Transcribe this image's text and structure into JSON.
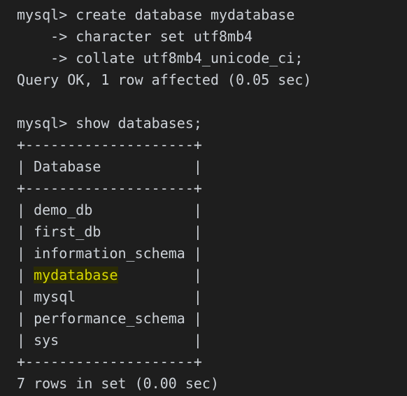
{
  "terminal": {
    "background_color": "#1e1e1e",
    "foreground_color": "#cdd2d8",
    "highlight_text_color": "#d7d700",
    "highlight_background_color": "#2b2b05",
    "prompt": "mysql>",
    "continuation_prompt": "->",
    "lines": [
      {
        "id": "cmd-create-database",
        "text": "mysql> create database mydatabase"
      },
      {
        "id": "cmd-character-set",
        "text": "    -> character set utf8mb4"
      },
      {
        "id": "cmd-collate",
        "text": "    -> collate utf8mb4_unicode_ci;"
      },
      {
        "id": "result-query-ok",
        "text": "Query OK, 1 row affected (0.05 sec)"
      },
      {
        "id": "blank-1",
        "text": ""
      },
      {
        "id": "cmd-show-databases",
        "text": "mysql> show databases;"
      },
      {
        "id": "table-border-top",
        "text": "+--------------------+"
      },
      {
        "id": "table-header-database",
        "text": "| Database           |"
      },
      {
        "id": "table-border-header",
        "text": "+--------------------+"
      },
      {
        "id": "row-demo-db",
        "text": "| demo_db            |"
      },
      {
        "id": "row-first-db",
        "text": "| first_db           |"
      },
      {
        "id": "row-information-schema",
        "text": "| information_schema |"
      },
      {
        "id": "row-mydatabase",
        "text": "| mydatabase         |",
        "highlight": "mydatabase"
      },
      {
        "id": "row-mysql",
        "text": "| mysql              |"
      },
      {
        "id": "row-performance-schema",
        "text": "| performance_schema |"
      },
      {
        "id": "row-sys",
        "text": "| sys                |"
      },
      {
        "id": "table-border-bottom",
        "text": "+--------------------+"
      },
      {
        "id": "result-rows-in-set",
        "text": "7 rows in set (0.00 sec)"
      }
    ]
  }
}
